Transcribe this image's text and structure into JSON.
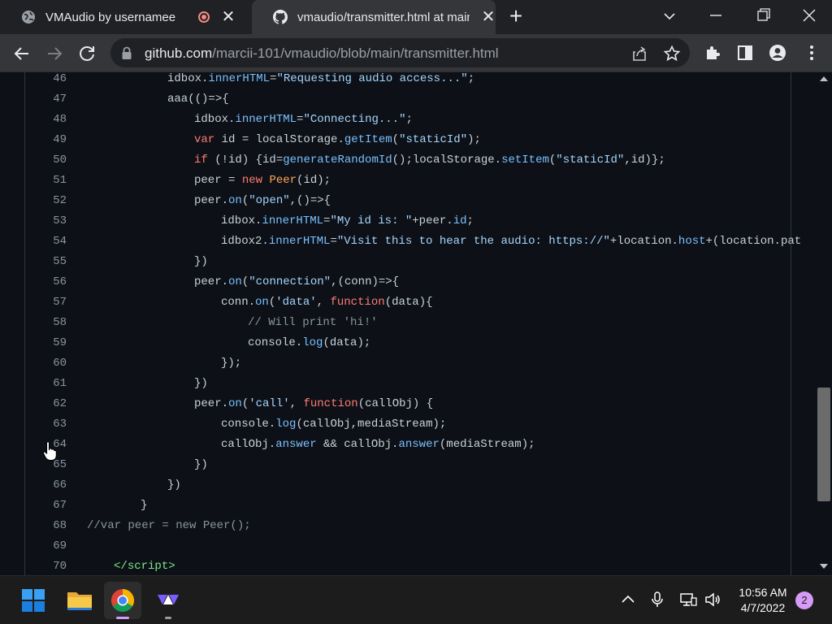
{
  "browser": {
    "tabs": [
      {
        "title": "VMAudio by usernamee",
        "favicon": "globe-icon",
        "recording": true
      },
      {
        "title": "vmaudio/transmitter.html at main",
        "favicon": "github-icon",
        "active": true
      }
    ],
    "address": {
      "host": "github.com",
      "path": "/marcii-101/vmaudio/blob/main/transmitter.html"
    }
  },
  "code": {
    "lines": [
      {
        "n": "46",
        "indent": 3,
        "tokens": [
          [
            "idbox.",
            ""
          ],
          [
            "innerHTML",
            "prop"
          ],
          [
            "=",
            ""
          ],
          [
            "\"Requesting audio access...\"",
            "str"
          ],
          [
            ";",
            ""
          ]
        ]
      },
      {
        "n": "47",
        "indent": 3,
        "tokens": [
          [
            "aaa",
            ""
          ],
          [
            "(()=>{",
            ""
          ]
        ]
      },
      {
        "n": "48",
        "indent": 4,
        "tokens": [
          [
            "idbox.",
            ""
          ],
          [
            "innerHTML",
            "prop"
          ],
          [
            "=",
            ""
          ],
          [
            "\"Connecting...\"",
            "str"
          ],
          [
            ";",
            ""
          ]
        ]
      },
      {
        "n": "49",
        "indent": 4,
        "tokens": [
          [
            "var",
            "kw"
          ],
          [
            " id = localStorage.",
            ""
          ],
          [
            "getItem",
            "prop"
          ],
          [
            "(",
            ""
          ],
          [
            "\"staticId\"",
            "str"
          ],
          [
            ");",
            ""
          ]
        ]
      },
      {
        "n": "50",
        "indent": 4,
        "tokens": [
          [
            "if",
            "kw"
          ],
          [
            " (!id) {id=",
            ""
          ],
          [
            "generateRandomId",
            "prop"
          ],
          [
            "();localStorage.",
            ""
          ],
          [
            "setItem",
            "prop"
          ],
          [
            "(",
            ""
          ],
          [
            "\"staticId\"",
            "str"
          ],
          [
            ",id)};",
            ""
          ]
        ]
      },
      {
        "n": "51",
        "indent": 4,
        "tokens": [
          [
            "peer = ",
            ""
          ],
          [
            "new",
            "kw"
          ],
          [
            " ",
            ""
          ],
          [
            "Peer",
            "cls"
          ],
          [
            "(id);",
            ""
          ]
        ]
      },
      {
        "n": "52",
        "indent": 4,
        "tokens": [
          [
            "peer.",
            ""
          ],
          [
            "on",
            "prop"
          ],
          [
            "(",
            ""
          ],
          [
            "\"open\"",
            "str"
          ],
          [
            ",()=>{",
            ""
          ]
        ]
      },
      {
        "n": "53",
        "indent": 5,
        "tokens": [
          [
            "idbox.",
            ""
          ],
          [
            "innerHTML",
            "prop"
          ],
          [
            "=",
            ""
          ],
          [
            "\"My id is: \"",
            "str"
          ],
          [
            "+peer.",
            ""
          ],
          [
            "id",
            "prop"
          ],
          [
            ";",
            ""
          ]
        ]
      },
      {
        "n": "54",
        "indent": 5,
        "tokens": [
          [
            "idbox2.",
            ""
          ],
          [
            "innerHTML",
            "prop"
          ],
          [
            "=",
            ""
          ],
          [
            "\"Visit this to hear the audio: https://\"",
            "str"
          ],
          [
            "+location.",
            ""
          ],
          [
            "host",
            "prop"
          ],
          [
            "+(location.pat",
            ""
          ]
        ]
      },
      {
        "n": "55",
        "indent": 4,
        "tokens": [
          [
            "})",
            ""
          ]
        ]
      },
      {
        "n": "56",
        "indent": 4,
        "tokens": [
          [
            "peer.",
            ""
          ],
          [
            "on",
            "prop"
          ],
          [
            "(",
            ""
          ],
          [
            "\"connection\"",
            "str"
          ],
          [
            ",(conn)=>{",
            ""
          ]
        ]
      },
      {
        "n": "57",
        "indent": 5,
        "tokens": [
          [
            "conn.",
            ""
          ],
          [
            "on",
            "prop"
          ],
          [
            "(",
            ""
          ],
          [
            "'data'",
            "str"
          ],
          [
            ", ",
            ""
          ],
          [
            "function",
            "kw"
          ],
          [
            "(data){",
            ""
          ]
        ]
      },
      {
        "n": "58",
        "indent": 6,
        "tokens": [
          [
            "// Will print 'hi!'",
            "cm"
          ]
        ]
      },
      {
        "n": "59",
        "indent": 6,
        "tokens": [
          [
            "console.",
            ""
          ],
          [
            "log",
            "prop"
          ],
          [
            "(data);",
            ""
          ]
        ]
      },
      {
        "n": "60",
        "indent": 5,
        "tokens": [
          [
            "});",
            ""
          ]
        ]
      },
      {
        "n": "61",
        "indent": 4,
        "tokens": [
          [
            "})",
            ""
          ]
        ]
      },
      {
        "n": "62",
        "indent": 4,
        "tokens": [
          [
            "peer.",
            ""
          ],
          [
            "on",
            "prop"
          ],
          [
            "(",
            ""
          ],
          [
            "'call'",
            "str"
          ],
          [
            ", ",
            ""
          ],
          [
            "function",
            "kw"
          ],
          [
            "(callObj) {",
            ""
          ]
        ]
      },
      {
        "n": "63",
        "indent": 5,
        "tokens": [
          [
            "console.",
            ""
          ],
          [
            "log",
            "prop"
          ],
          [
            "(callObj,mediaStream);",
            ""
          ]
        ]
      },
      {
        "n": "64",
        "indent": 5,
        "tokens": [
          [
            "callObj.",
            ""
          ],
          [
            "answer",
            "prop"
          ],
          [
            " && ",
            ""
          ],
          [
            "callObj.",
            ""
          ],
          [
            "answer",
            "prop"
          ],
          [
            "(mediaStream);",
            ""
          ]
        ]
      },
      {
        "n": "65",
        "indent": 4,
        "tokens": [
          [
            "})",
            ""
          ]
        ]
      },
      {
        "n": "66",
        "indent": 3,
        "tokens": [
          [
            "})",
            ""
          ]
        ]
      },
      {
        "n": "67",
        "indent": 2,
        "tokens": [
          [
            "}",
            ""
          ]
        ]
      },
      {
        "n": "68",
        "indent": 0,
        "tokens": [
          [
            "//var peer = new Peer();",
            "cm"
          ]
        ]
      },
      {
        "n": "69",
        "indent": 0,
        "tokens": []
      },
      {
        "n": "70",
        "indent": 1,
        "tokens": [
          [
            "</",
            "tag"
          ],
          [
            "script",
            "tag"
          ],
          [
            ">",
            "tag"
          ]
        ]
      }
    ]
  },
  "taskbar": {
    "apps": [
      "windows-start-icon",
      "file-explorer-icon",
      "chrome-icon",
      "vmaudio-app-icon"
    ],
    "time": "10:56 AM",
    "date": "4/7/2022",
    "notifications": "2"
  },
  "colors": {
    "accent": "#d59bf6",
    "code_bg": "#0d1117",
    "tab_active": "#35363a"
  }
}
